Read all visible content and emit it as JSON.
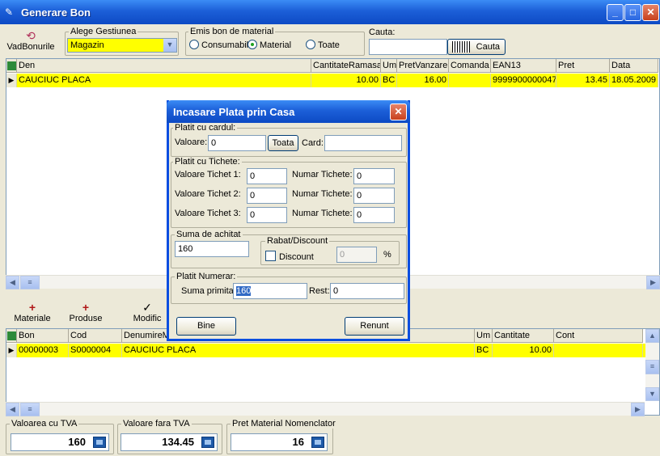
{
  "window": {
    "title": "Generare Bon"
  },
  "toolbar": {
    "vad_bonurile": "VadBonurile",
    "gestiune_label": "Alege Gestiunea",
    "gestiune_value": "Magazin",
    "emis_label": "Emis bon de material",
    "radio_consumabil": "Consumabil",
    "radio_material": "Material",
    "radio_toate": "Toate",
    "cauta_label": "Cauta:",
    "cauta_value": "",
    "cauta_button": "Cauta"
  },
  "top_grid": {
    "columns": [
      "Den",
      "CantitateRamasa",
      "Um",
      "PretVanzare",
      "Comanda",
      "EAN13",
      "Pret",
      "Data"
    ],
    "rows": [
      [
        "CAUCIUC PLACA",
        "10.00",
        "BC",
        "16.00",
        "",
        "9999900000047",
        "13.45",
        "18.05.2009"
      ]
    ]
  },
  "mid_toolbar": {
    "materiale": "Materiale",
    "produse": "Produse",
    "modific": "Modific"
  },
  "bottom_grid": {
    "columns": [
      "Bon",
      "Cod",
      "DenumireM",
      "Um",
      "Cantitate",
      "Cont"
    ],
    "rows": [
      [
        "00000003",
        "S0000004",
        "CAUCIUC PLACA",
        "BC",
        "10.00",
        ""
      ]
    ]
  },
  "totals": {
    "cu_tva_label": "Valoarea cu TVA",
    "cu_tva_value": "160",
    "fara_tva_label": "Valoare fara TVA",
    "fara_tva_value": "134.45",
    "pret_label": "Pret Material Nomenclator",
    "pret_value": "16"
  },
  "dialog": {
    "title": "Incasare Plata prin Casa",
    "card_group": "Platit cu cardul:",
    "valoare_label": "Valoare:",
    "valoare_value": "0",
    "toata_button": "Toata",
    "card_label": "Card:",
    "card_value": "",
    "tichete_group": "Platit cu Tichete:",
    "ticket1_label": "Valoare Tichet 1:",
    "ticket1_value": "0",
    "ticket2_label": "Valoare Tichet 2:",
    "ticket2_value": "0",
    "ticket3_label": "Valoare Tichet 3:",
    "ticket3_value": "0",
    "numar_label": "Numar Tichete:",
    "numar1_value": "0",
    "numar2_value": "0",
    "numar3_value": "0",
    "suma_group": "Suma de achitat",
    "suma_value": "160",
    "rabat_group": "Rabat/Discount",
    "discount_label": "Discount",
    "discount_value": "0",
    "percent": "%",
    "numerar_group": "Platit Numerar:",
    "suma_primita_label": "Suma primita:",
    "suma_primita_value": "160",
    "rest_label": "Rest:",
    "rest_value": "0",
    "bine_button": "Bine",
    "renunt_button": "Renunt"
  }
}
